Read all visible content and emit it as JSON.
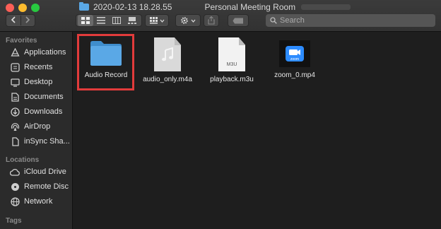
{
  "window": {
    "title_date": "2020-02-13 18.28.55",
    "title_suffix": "Personal Meeting Room"
  },
  "toolbar": {
    "back_icon": "chevron-left-icon",
    "forward_icon": "chevron-right-icon",
    "views": [
      "icon-view",
      "list-view",
      "column-view",
      "gallery-view"
    ],
    "active_view": "icon-view",
    "search_placeholder": "Search"
  },
  "sidebar": {
    "favorites_header": "Favorites",
    "favorites": [
      {
        "label": "Applications",
        "icon": "applications-icon"
      },
      {
        "label": "Recents",
        "icon": "recents-icon"
      },
      {
        "label": "Desktop",
        "icon": "desktop-icon"
      },
      {
        "label": "Documents",
        "icon": "documents-icon"
      },
      {
        "label": "Downloads",
        "icon": "downloads-icon"
      },
      {
        "label": "AirDrop",
        "icon": "airdrop-icon"
      },
      {
        "label": "inSync Sha...",
        "icon": "file-icon"
      }
    ],
    "locations_header": "Locations",
    "locations": [
      {
        "label": "iCloud Drive",
        "icon": "cloud-icon"
      },
      {
        "label": "Remote Disc",
        "icon": "disc-icon"
      },
      {
        "label": "Network",
        "icon": "network-icon"
      }
    ],
    "tags_header": "Tags"
  },
  "files": [
    {
      "name": "Audio Record",
      "kind": "folder",
      "selected": true
    },
    {
      "name": "audio_only.m4a",
      "kind": "audio",
      "selected": false
    },
    {
      "name": "playback.m3u",
      "kind": "playlist",
      "badge": "M3U",
      "selected": false
    },
    {
      "name": "zoom_0.mp4",
      "kind": "video",
      "badge": "zoom",
      "selected": false
    }
  ],
  "colors": {
    "selection_outline": "#e23b3b",
    "folder": "#5aa8e6",
    "zoom_blue": "#2d8cff"
  }
}
